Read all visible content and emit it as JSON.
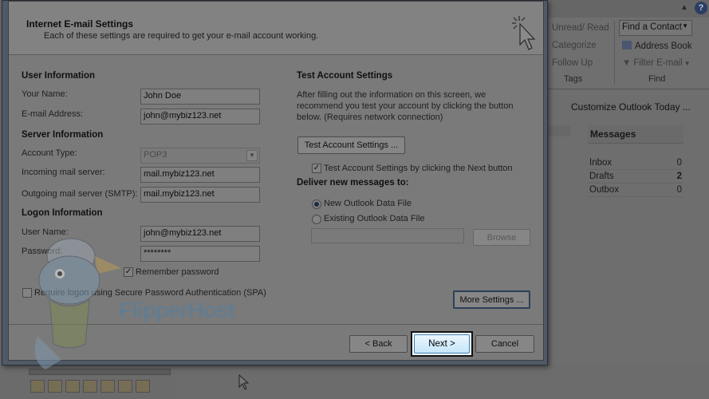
{
  "ribbon": {
    "unread_read": "Unread/ Read",
    "categorize": "Categorize",
    "follow_up": "Follow Up",
    "tags_group": "Tags",
    "find_contact": "Find a Contact",
    "address_book": "Address Book",
    "filter_email": "Filter E-mail",
    "find_group": "Find"
  },
  "outlook": {
    "customize_link": "Customize Outlook Today ...",
    "messages_header": "Messages",
    "folders": [
      {
        "name": "Inbox",
        "count": "0"
      },
      {
        "name": "Drafts",
        "count": "2"
      },
      {
        "name": "Outbox",
        "count": "0"
      }
    ]
  },
  "dialog": {
    "title": "Internet E-mail Settings",
    "subtitle": "Each of these settings are required to get your e-mail account working.",
    "user_info": {
      "heading": "User Information",
      "name_label": "Your Name:",
      "name_value": "John Doe",
      "email_label": "E-mail Address:",
      "email_value": "john@mybiz123.net"
    },
    "server_info": {
      "heading": "Server Information",
      "account_type_label": "Account Type:",
      "account_type_value": "POP3",
      "incoming_label": "Incoming mail server:",
      "incoming_value": "mail.mybiz123.net",
      "outgoing_label": "Outgoing mail server (SMTP):",
      "outgoing_value": "mail.mybiz123.net"
    },
    "logon_info": {
      "heading": "Logon Information",
      "username_label": "User Name:",
      "username_value": "john@mybiz123.net",
      "password_label": "Password:",
      "password_value": "********",
      "remember_label": "Remember password",
      "remember_checked": true,
      "spa_label": "Require logon using Secure Password Authentication (SPA)",
      "spa_checked": false
    },
    "test": {
      "heading": "Test Account Settings",
      "description": "After filling out the information on this screen, we recommend you test your account by clicking the button below. (Requires network connection)",
      "test_button": "Test Account Settings ...",
      "test_next_label": "Test Account Settings by clicking the Next button",
      "test_next_checked": true
    },
    "deliver": {
      "heading": "Deliver new messages to:",
      "new_file_label": "New Outlook Data File",
      "existing_file_label": "Existing Outlook Data File",
      "selected": "new",
      "existing_path": "",
      "browse_button": "Browse"
    },
    "more_settings_button": "More Settings ...",
    "back_button": "< Back",
    "next_button": "Next >",
    "cancel_button": "Cancel"
  },
  "watermark": {
    "brand": "FlipperHost"
  }
}
